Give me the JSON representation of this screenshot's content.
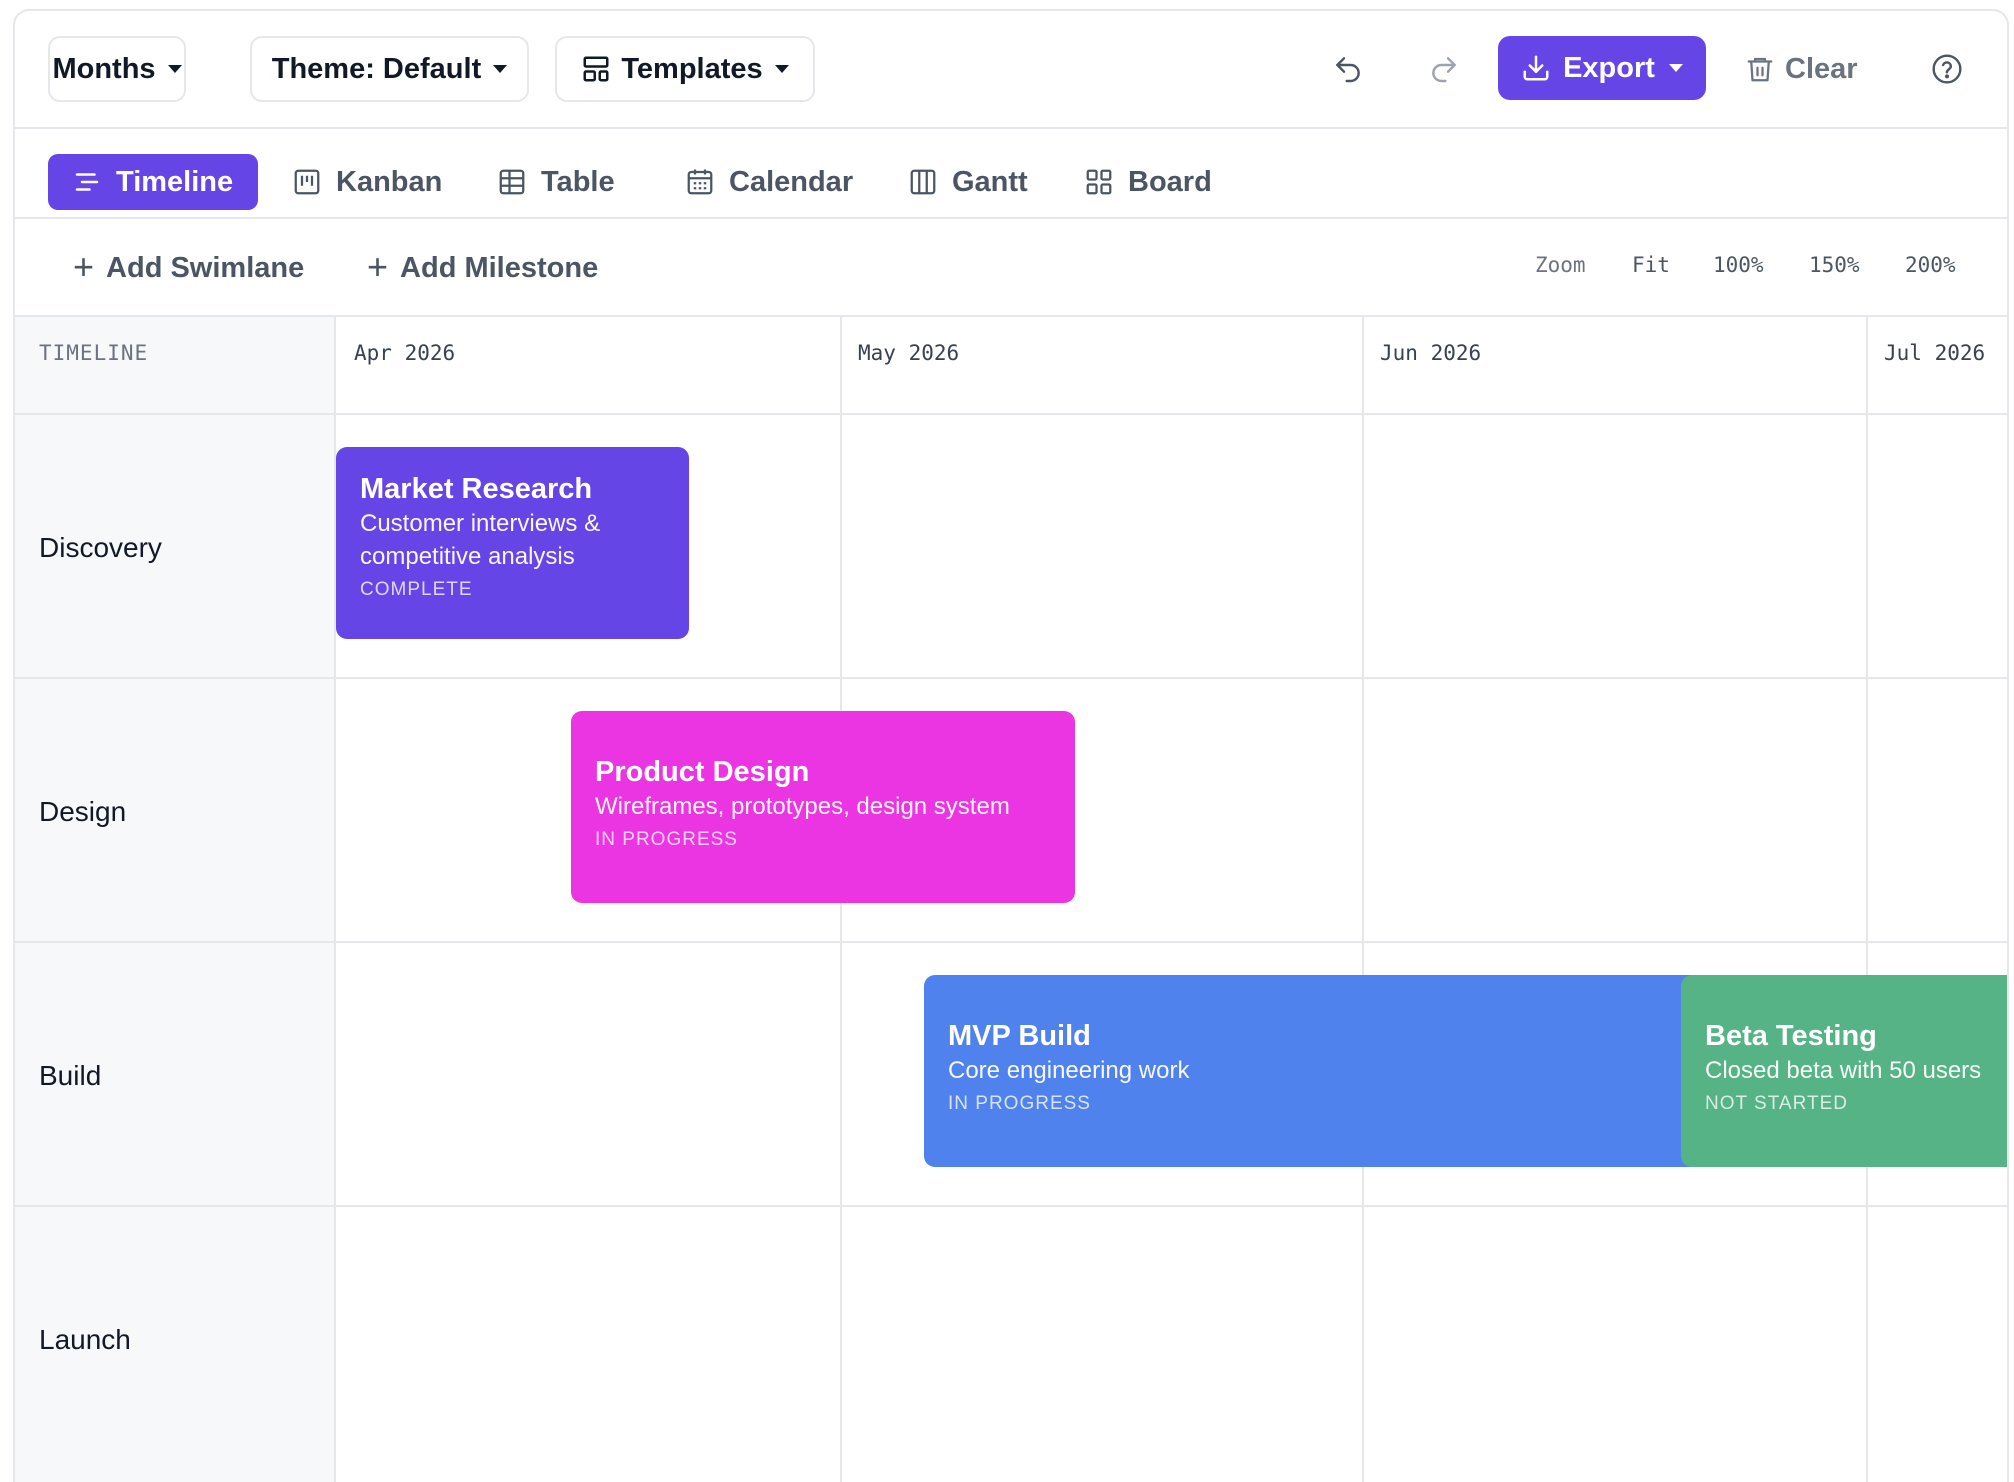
{
  "toolbar": {
    "months_label": "Months",
    "theme_label": "Theme: Default",
    "templates_label": "Templates",
    "export_label": "Export",
    "clear_label": "Clear"
  },
  "tabs": [
    {
      "label": "Timeline",
      "icon": "timeline-icon",
      "active": true
    },
    {
      "label": "Kanban",
      "icon": "kanban-icon",
      "active": false
    },
    {
      "label": "Table",
      "icon": "table-icon",
      "active": false
    },
    {
      "label": "Calendar",
      "icon": "calendar-icon",
      "active": false
    },
    {
      "label": "Gantt",
      "icon": "gantt-icon",
      "active": false
    },
    {
      "label": "Board",
      "icon": "board-icon",
      "active": false
    }
  ],
  "actions": {
    "add_swimlane": "Add Swimlane",
    "add_milestone": "Add Milestone"
  },
  "zoom": {
    "label": "Zoom",
    "options": [
      "Fit",
      "100%",
      "150%",
      "200%"
    ]
  },
  "timeline": {
    "header_label": "TIMELINE",
    "months": [
      "Apr 2026",
      "May 2026",
      "Jun 2026",
      "Jul 2026"
    ],
    "lanes": [
      "Discovery",
      "Design",
      "Build",
      "Launch"
    ]
  },
  "tasks": [
    {
      "title": "Market Research",
      "description": "Customer interviews & competitive analysis",
      "status": "COMPLETE",
      "color": "#6545e6",
      "lane": "Discovery"
    },
    {
      "title": "Product Design",
      "description": "Wireframes, prototypes, design system",
      "status": "IN PROGRESS",
      "color": "#eb34e2",
      "lane": "Design"
    },
    {
      "title": "MVP Build",
      "description": "Core engineering work",
      "status": "IN PROGRESS",
      "color": "#4f82ec",
      "lane": "Build"
    },
    {
      "title": "Beta Testing",
      "description": "Closed beta with 50 users",
      "status": "NOT STARTED",
      "color": "#55b386",
      "lane": "Build"
    }
  ],
  "colors": {
    "accent": "#6545e6",
    "border": "#e5e7eb",
    "label_bg": "#f7f8fa"
  }
}
